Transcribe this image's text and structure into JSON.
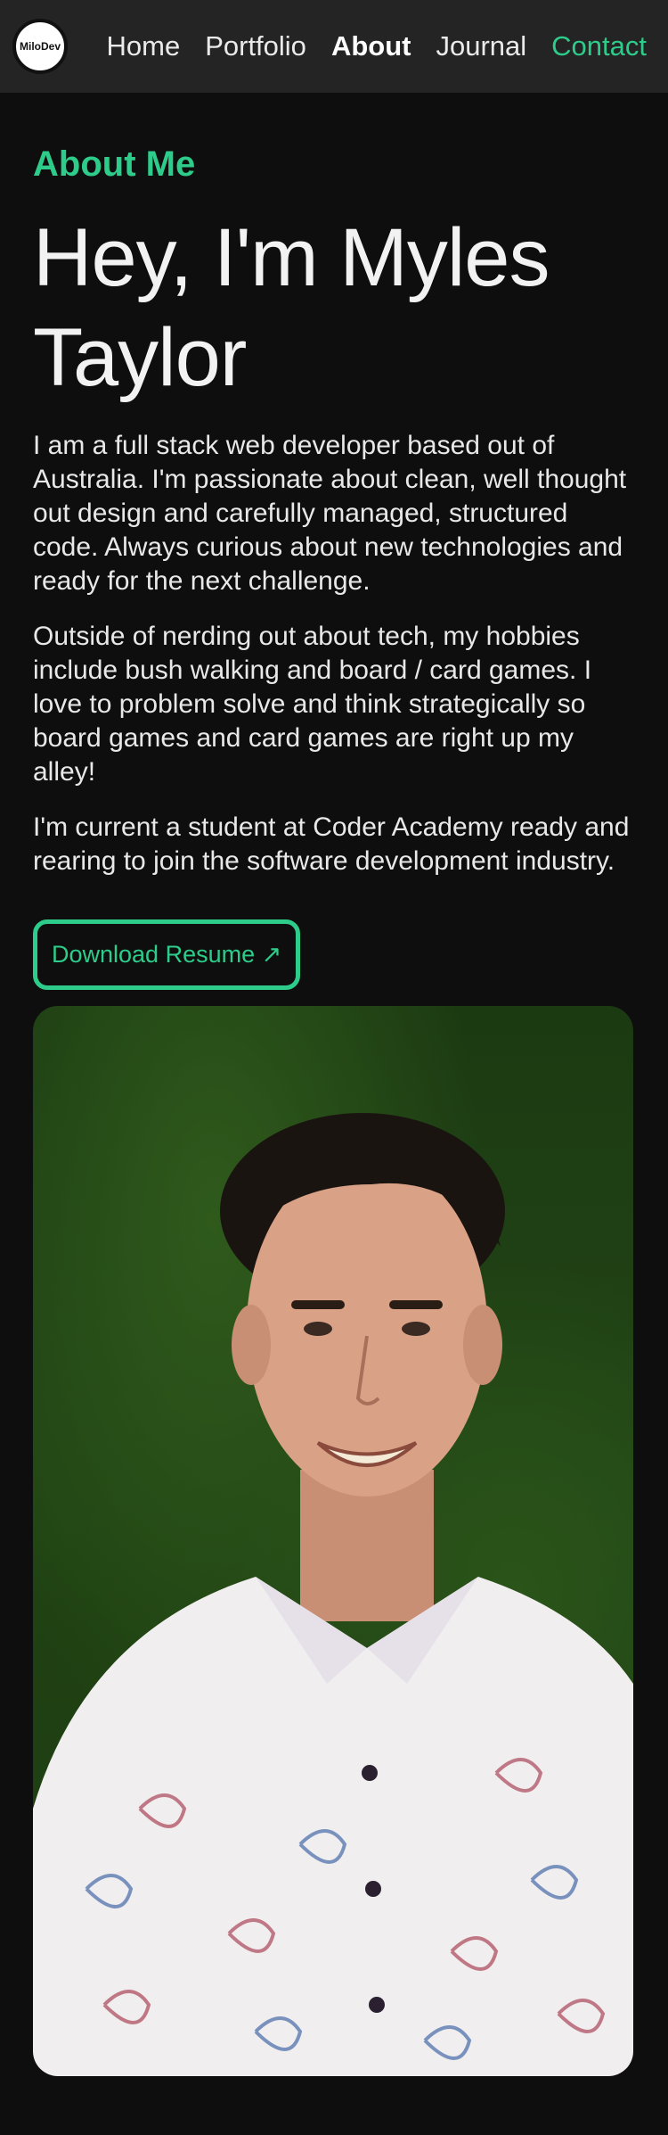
{
  "nav": {
    "logo_text": "MiloDev",
    "links": [
      "Home",
      "Portfolio",
      "About",
      "Journal",
      "Contact"
    ],
    "active": "About",
    "accent_color": "#2ecc8a"
  },
  "about": {
    "eyebrow": "About Me",
    "heading": "Hey, I'm Myles Taylor",
    "paragraphs": [
      "I am a full stack web developer based out of Australia. I'm passionate about clean, well thought out design and carefully managed, structured code. Always curious about new technologies and ready for the next challenge.",
      "Outside of nerding out about tech, my hobbies include bush walking and board / card games. I love to problem solve and think strategically so board games and card games are right up my alley!",
      "I'm current a student at Coder Academy ready and rearing to join the software development industry."
    ],
    "resume_button": "Download Resume ↗"
  },
  "photo": {
    "subject": "portrait-photo"
  }
}
